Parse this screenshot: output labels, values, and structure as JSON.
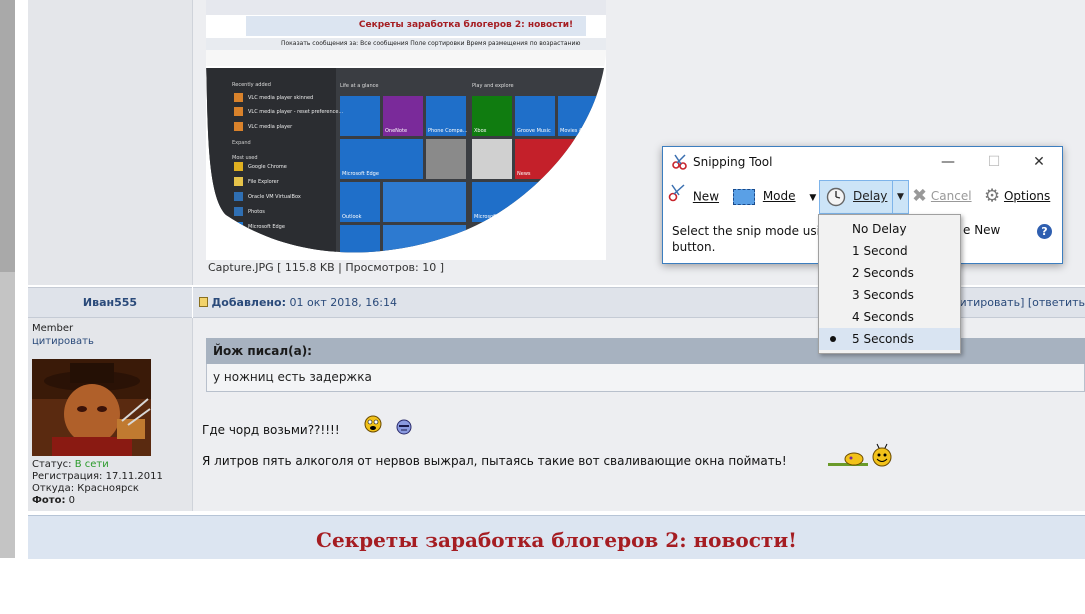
{
  "screenshot": {
    "caption": "Capture.JPG [ 115.8 KB | Просмотров: 10 ]",
    "inner_banner": "Секреты заработка блогеров 2: новости!",
    "inner_filter": {
      "show_label": "Показать сообщения за:",
      "show_value": "Все сообщения",
      "sort_label": "Поле сортировки",
      "sort_value": "Время размещения",
      "order_value": "по возрастанию"
    },
    "start_menu": {
      "recent_header": "Recently added",
      "recent_items": [
        "VLC media player skinned",
        "VLC media player - reset preference...",
        "VLC media player"
      ],
      "expand": "Expand",
      "most_used_header": "Most used",
      "most_used_items": [
        "Google Chrome",
        "File Explorer",
        "Oracle VM VirtualBox",
        "Photos",
        "Microsoft Edge"
      ],
      "life_header": "Life at a glance",
      "play_header": "Play and explore",
      "tiles": [
        "Xbox",
        "Groove Music",
        "Movies & TV",
        "Microsoft Edge",
        "Outlook",
        "Microsoft Store",
        "News",
        "OneNote",
        "Phone Compa..."
      ]
    }
  },
  "post": {
    "username": "Иван555",
    "date_label": "Добавлено:",
    "date_value": "01 окт 2018, 16:14",
    "actions": "[цитировать] [ответить",
    "user_rank": "Member",
    "user_quote_link": "цитировать",
    "status_label": "Статус:",
    "status_value": "В сети",
    "reg_label": "Регистрация:",
    "reg_value": "17.11.2011",
    "from_label": "Откуда:",
    "from_value": "Красноярск",
    "photo_label": "Фото:",
    "photo_value": "0",
    "quote_author": "Йож писал(а):",
    "quote_text": "у ножниц есть задержка",
    "line1": "Где чорд возьми??!!!!",
    "line2": "Я литров пять алкоголя от нервов выжрал, пытаясь такие вот сваливающие окна поймать!"
  },
  "banner": "Секреты заработка блогеров 2: новости!",
  "snipping_tool": {
    "title": "Snipping Tool",
    "new_label": "New",
    "mode_label": "Mode",
    "delay_label": "Delay",
    "cancel_label": "Cancel",
    "options_label": "Options",
    "message_left": "Select the snip mode using",
    "message_right": "e New",
    "message_line2": "button."
  },
  "delay_menu": {
    "items": [
      "No Delay",
      "1 Second",
      "2 Seconds",
      "3 Seconds",
      "4 Seconds",
      "5 Seconds"
    ],
    "selected_index": 5
  },
  "colors": {
    "banner_text": "#a51d22",
    "online": "#2a9a2a",
    "link": "#2a4a7a",
    "delay_active": "#cce4f7"
  }
}
